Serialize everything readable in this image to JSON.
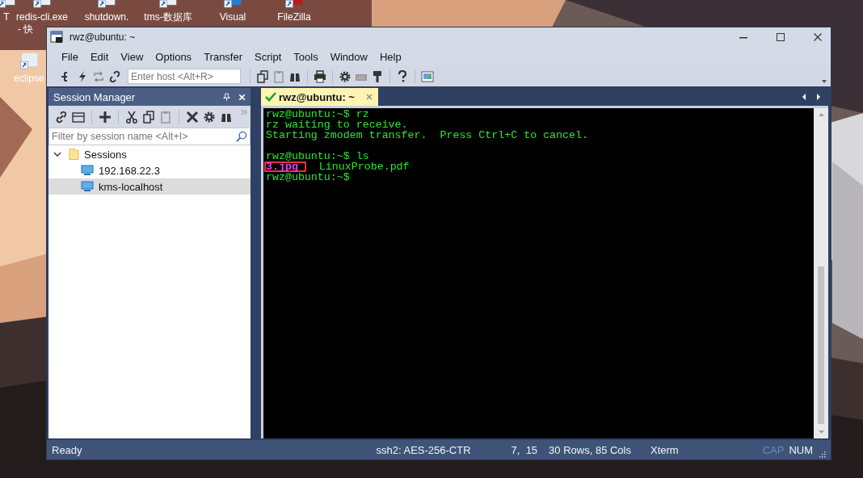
{
  "desktop": {
    "icons": [
      {
        "lines": [
          "T"
        ]
      },
      {
        "lines": [
          "redis-cli.exe",
          "- 快"
        ]
      },
      {
        "lines": [
          "shutdown."
        ]
      },
      {
        "lines": [
          "tms-数据库"
        ]
      },
      {
        "lines": [
          "Visual"
        ]
      },
      {
        "lines": [
          "FileZilla"
        ]
      },
      {
        "lines": [
          "eclipse"
        ]
      }
    ]
  },
  "window": {
    "title": "rwz@ubuntu: ~",
    "menu": [
      "File",
      "Edit",
      "View",
      "Options",
      "Transfer",
      "Script",
      "Tools",
      "Window",
      "Help"
    ],
    "toolbar": {
      "host_field": {
        "placeholder": "Enter host <Alt+R>"
      }
    },
    "session_manager": {
      "title": "Session Manager",
      "filter": {
        "placeholder": "Filter by session name <Alt+I>"
      },
      "tree": [
        {
          "label": "Sessions",
          "expanded": true,
          "selected": false,
          "children": [
            {
              "label": "192.168.22.3",
              "selected": false
            },
            {
              "label": "kms-localhost",
              "selected": true
            }
          ]
        }
      ]
    },
    "tabs": [
      {
        "label": "rwz@ubuntu: ~",
        "connected": true,
        "selected": true
      }
    ],
    "terminal": {
      "blocks": [
        {
          "lines": [
            {
              "segments": [
                {
                  "text": "rwz@ubuntu:~$ rz",
                  "kind": "normal"
                }
              ]
            },
            {
              "segments": [
                {
                  "text": "rz waiting to receive.",
                  "kind": "normal"
                }
              ]
            },
            {
              "segments": [
                {
                  "text": "Starting zmodem transfer.  Press Ctrl+C to cancel.",
                  "kind": "normal"
                }
              ]
            }
          ]
        },
        {
          "lines": [
            {
              "segments": [
                {
                  "text": "rwz@ubuntu:~$ ls",
                  "kind": "normal"
                }
              ]
            },
            {
              "segments": [
                {
                  "text": "3.jpg",
                  "highlighted": true
                },
                {
                  "text": "  LinuxProbe.pdf",
                  "kind": "normal",
                  "highlighted": false
                }
              ]
            },
            {
              "segments": [
                {
                  "text": "rwz@ubuntu:~$",
                  "kind": "normal"
                }
              ]
            }
          ]
        }
      ]
    },
    "status_bar": [
      {
        "text": "Ready",
        "kind": "left",
        "disabled": false
      },
      {
        "text": "ssh2: AES-256-CTR",
        "kind": "right",
        "disabled": false
      },
      {
        "text": "7,  15",
        "kind": "right",
        "disabled": false
      },
      {
        "text": "30 Rows, 85 Cols",
        "kind": "right",
        "disabled": false
      },
      {
        "text": "Xterm",
        "kind": "right",
        "disabled": false
      },
      {
        "text": "CAP",
        "kind": "right",
        "disabled": true
      },
      {
        "text": "NUM",
        "kind": "right",
        "disabled": false
      }
    ]
  }
}
